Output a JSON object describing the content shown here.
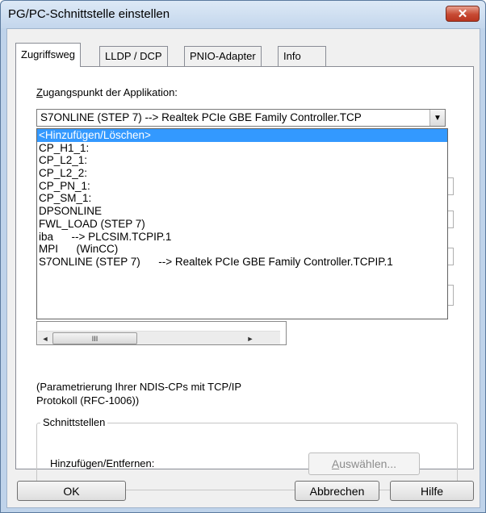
{
  "window": {
    "title": "PG/PC-Schnittstelle einstellen",
    "close_glyph": "✕"
  },
  "tabs": [
    {
      "label": "Zugriffsweg",
      "active": true
    },
    {
      "label": "LLDP / DCP",
      "active": false
    },
    {
      "label": "PNIO-Adapter",
      "active": false
    },
    {
      "label": "Info",
      "active": false
    }
  ],
  "access_point": {
    "label_first": "Z",
    "label_rest": "ugangspunkt der Applikation:",
    "value": "S7ONLINE (STEP 7)      --> Realtek PCIe GBE Family Controller.TCP",
    "arrow_glyph": "▼"
  },
  "dropdown_items": [
    "<Hinzufügen/Löschen>",
    "CP_H1_1:",
    "CP_L2_1:",
    "CP_L2_2:",
    "CP_PN_1:",
    "CP_SM_1:",
    "DPSONLINE",
    "FWL_LOAD (STEP 7)",
    "iba      --> PLCSIM.TCPIP.1",
    "MPI      (WinCC)",
    "S7ONLINE (STEP 7)      --> Realtek PCIe GBE Family Controller.TCPIP.1"
  ],
  "scrollbar": {
    "left_glyph": "◄",
    "thumb_glyph": "III",
    "right_glyph": "►"
  },
  "description_line1": "(Parametrierung Ihrer NDIS-CPs mit TCP/IP",
  "description_line2": "Protokoll (RFC-1006))",
  "interfaces": {
    "legend": "Schnittstellen",
    "add_remove_label": "Hinzufügen/Entfernen:",
    "select_button_first": "A",
    "select_button_rest": "uswählen..."
  },
  "buttons": {
    "ok": "OK",
    "cancel": "Abbrechen",
    "help": "Hilfe"
  }
}
